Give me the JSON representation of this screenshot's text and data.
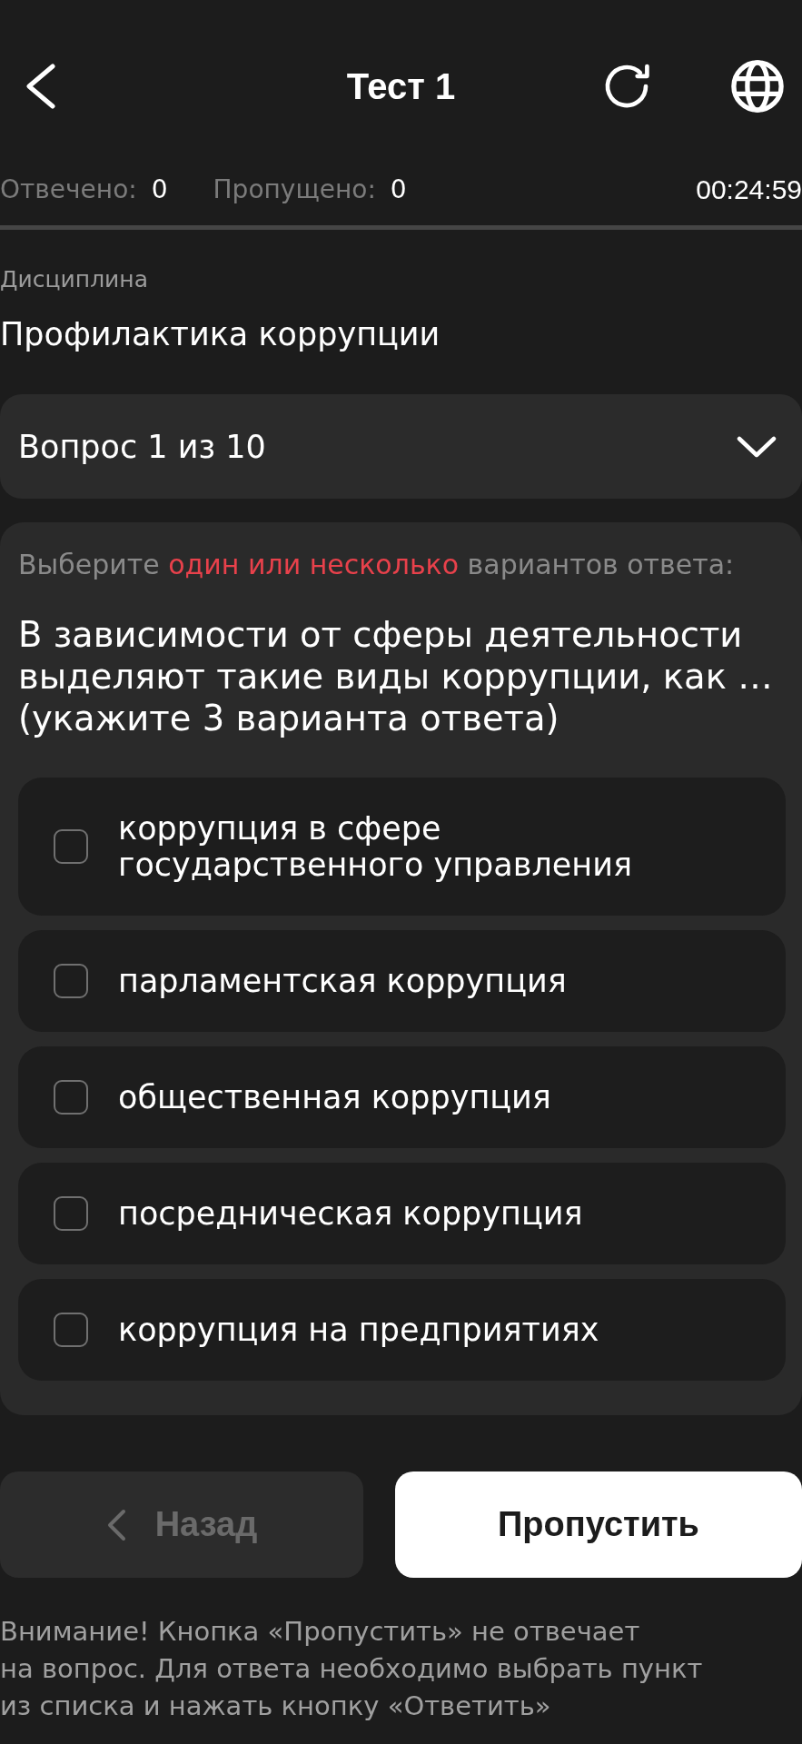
{
  "header": {
    "title": "Тест 1"
  },
  "stats": [
    {
      "label": "Отвечено:",
      "value": "0"
    },
    {
      "label": "Пропущено:",
      "value": "0"
    }
  ],
  "timer": "00:24:59",
  "discipline": {
    "label": "Дисциплина",
    "value": "Профилактика коррупции"
  },
  "question_selector": {
    "label": "Вопрос 1 из 10",
    "expanded": false
  },
  "question": {
    "instruction": [
      {
        "text": "Выберите ",
        "highlight": false
      },
      {
        "text": "один или несколько",
        "highlight": true
      },
      {
        "text": " вариантов ответа:",
        "highlight": false
      }
    ],
    "text": "В зависимости от сферы деятельности выделяют такие виды коррупции, как … (укажите 3 варианта ответа)",
    "options": [
      {
        "text": "коррупция в сфере государственного управления",
        "checked": false
      },
      {
        "text": "парламентская коррупция",
        "checked": false
      },
      {
        "text": "общественная коррупция",
        "checked": false
      },
      {
        "text": "посредническая коррупция",
        "checked": false
      },
      {
        "text": "коррупция на предприятиях",
        "checked": false
      }
    ]
  },
  "buttons": [
    {
      "kind": "back",
      "label": "Назад",
      "disabled": true
    },
    {
      "kind": "primary",
      "label": "Пропустить",
      "disabled": false
    }
  ],
  "note": "Внимание! Кнопка «Пропустить» не отвечает\nна вопрос. Для ответа необходимо выбрать пункт\nиз списка и нажать кнопку «Ответить»"
}
